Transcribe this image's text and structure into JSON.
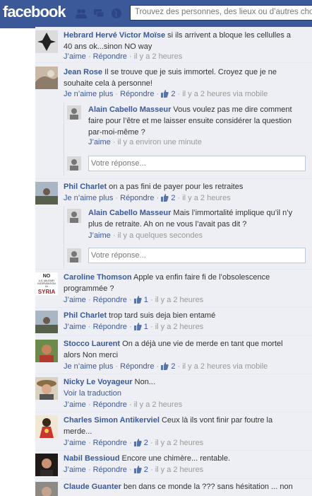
{
  "app": {
    "logo": "facebook",
    "search_placeholder": "Trouvez des personnes, des lieux ou d’autres choses",
    "icons": [
      "friends-icon",
      "messages-icon",
      "notifications-icon",
      "search-icon"
    ]
  },
  "colors": {
    "brand": "#3b5998",
    "link": "#3b5998",
    "meta": "#999999",
    "feed_bg": "#edeff4"
  },
  "reply_placeholder": "Votre réponse...",
  "comments": [
    {
      "author": "Hebrard Hervé Victor Moïse",
      "text_l1": " si ils arrivent a bloque les cellulles a",
      "text_l2": "40 ans ok...sinon NO way",
      "like": "J’aime",
      "reply": "Répondre",
      "time": "il y a 2 heures"
    },
    {
      "author": "Jean Rose",
      "text_l1": " Il se trouve que je suis immortel. Croyez que je ne",
      "text_l2": "souhaite cela à personne!",
      "like": "Je n’aime plus",
      "reply": "Répondre",
      "count": "2",
      "time": "il y a 2 heures via mobile"
    },
    {
      "author": "Phil Charlet",
      "text_l1": " on a pas fini de payer pour les retraites",
      "like": "Je n’aime plus",
      "reply": "Répondre",
      "count": "2",
      "time": "il y a 2 heures"
    },
    {
      "author": "Caroline Thomson",
      "text_l1": " Apple va enfin faire fi de l’obsolescence",
      "text_l2": "programmée ?",
      "like": "J’aime",
      "reply": "Répondre",
      "count": "1",
      "time": "il y a 2 heures",
      "avatar_text": [
        "NO",
        "U.S. MILITARY",
        "INTERVENTION",
        "IN",
        "SYRIA"
      ]
    },
    {
      "author": "Phil Charlet",
      "text_l1": " trop tard suis deja bien entamé",
      "like": "J’aime",
      "reply": "Répondre",
      "count": "1",
      "time": "il y a 2 heures"
    },
    {
      "author": "Stocco Laurent",
      "text_l1": " On a déjà une vie de merde en tant que mortel",
      "text_l2": "alors Non merci",
      "like": "Je n’aime plus",
      "reply": "Répondre",
      "count": "2",
      "time": "il y a 2 heures via mobile"
    },
    {
      "author": "Nicky Le Voyageur",
      "text_l1": " Non...",
      "translate": "Voir la traduction",
      "like": "J’aime",
      "reply": "Répondre",
      "time": "il y a 2 heures"
    },
    {
      "author": "Charles Simon Antikerviel",
      "text_l1": " Ceux là ils vont finir par foutre la",
      "text_l2": "merde...",
      "like": "J’aime",
      "reply": "Répondre",
      "count": "2",
      "time": "il y a 2 heures"
    },
    {
      "author": "Nabil Bessioud",
      "text_l1": " Encore une chimère... rentable.",
      "like": "J’aime",
      "reply": "Répondre",
      "count": "2",
      "time": "il y a 2 heures"
    },
    {
      "author": "Claude Guanter",
      "text_l1": " ben dans ce monde la ??? sans hésitation ... non"
    }
  ],
  "replies": [
    {
      "author": "Alain Cabello Masseur",
      "text_l1": " Vous voulez pas me dire comment",
      "text_l2": "faire pour l’être et me laisser ensuite considérer la question",
      "text_l3": "par-moi-même ?",
      "like": "J’aime",
      "time": "il y a environ une minute"
    },
    {
      "author": "Alain Cabello Masseur",
      "text_l1": " Mais l’immortalité implique qu’il n’y",
      "text_l2": "plus de retraite. Ah on ne vous l’avait pas dit ?",
      "like": "J’aime",
      "time": "il y a quelques secondes"
    }
  ]
}
